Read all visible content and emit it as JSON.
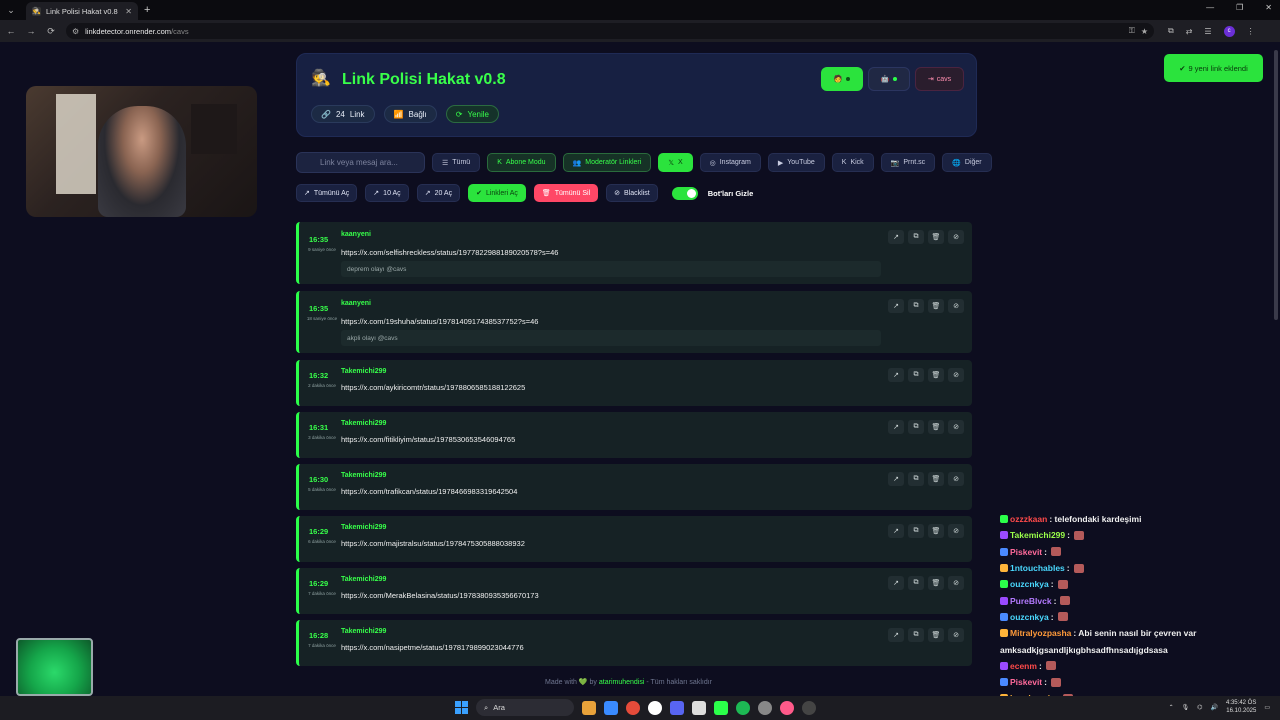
{
  "browser": {
    "tab_title": "Link Polisi Hakat v0.8",
    "url_host": "linkdetector.onrender.com",
    "url_path": "/cavs",
    "profile_initial": "c"
  },
  "header": {
    "title": "Link Polisi Hakat v0.8",
    "logout_label": "cavs",
    "stats": {
      "link_count": "24",
      "link_label": "Link",
      "connection": "Bağlı",
      "refresh": "Yenile"
    }
  },
  "filters": {
    "search_placeholder": "Link veya mesaj ara...",
    "items": [
      "Tümü",
      "Abone Modu",
      "Moderatör Linkleri",
      "X",
      "Instagram",
      "YouTube",
      "Kick",
      "Prnt.sc",
      "Diğer"
    ]
  },
  "actions": {
    "open_all": "Tümünü Aç",
    "open_10": "10 Aç",
    "open_20": "20 Aç",
    "open_checked": "Linkleri Aç",
    "delete_all": "Tümünü Sil",
    "blacklist": "Blacklist",
    "hide_bots": "Bot'ları Gizle"
  },
  "links": [
    {
      "time": "16:35",
      "ago": "9 saniye önce",
      "user": "kaanyeni",
      "url": "https://x.com/selfishreckless/status/1977822988189020578?s=46",
      "msg": "deprem olayı @cavs"
    },
    {
      "time": "16:35",
      "ago": "18 saniye önce",
      "user": "kaanyeni",
      "url": "https://x.com/19shuha/status/1978140917438537752?s=46",
      "msg": "akpli olayı @cavs"
    },
    {
      "time": "16:32",
      "ago": "2 dakika önce",
      "user": "Takemichi299",
      "url": "https://x.com/aykiricomtr/status/1978806585188122625",
      "msg": ""
    },
    {
      "time": "16:31",
      "ago": "3 dakika önce",
      "user": "Takemichi299",
      "url": "https://x.com/fitikliyim/status/1978530653546094765",
      "msg": ""
    },
    {
      "time": "16:30",
      "ago": "5 dakika önce",
      "user": "Takemichi299",
      "url": "https://x.com/trafikcan/status/1978466983319642504",
      "msg": ""
    },
    {
      "time": "16:29",
      "ago": "6 dakika önce",
      "user": "Takemichi299",
      "url": "https://x.com/majistralsu/status/1978475305888038932",
      "msg": ""
    },
    {
      "time": "16:29",
      "ago": "7 dakika önce",
      "user": "Takemichi299",
      "url": "https://x.com/MerakBelasina/status/1978380935356670173",
      "msg": ""
    },
    {
      "time": "16:28",
      "ago": "7 dakika önce",
      "user": "Takemichi299",
      "url": "https://x.com/nasipetme/status/1978179899023044776",
      "msg": ""
    }
  ],
  "footer": {
    "made_with": "Made with",
    "by": "by",
    "author": "atarimuhendisi",
    "rights": "- Tüm hakları saklıdır"
  },
  "toast": "9 yeni link eklendi",
  "chat": [
    {
      "user": "ozzzkaan",
      "color": "#ff4a4a",
      "text": " : telefondaki kardeşimi"
    },
    {
      "user": "Takemichi299",
      "color": "#9aff4a",
      "text": " :"
    },
    {
      "user": "Piskevit",
      "color": "#ff6a9a",
      "text": " :"
    },
    {
      "user": "1ntouchables",
      "color": "#4ad9ff",
      "text": " :"
    },
    {
      "user": "ouzcnkya",
      "color": "#4ad9ff",
      "text": " :"
    },
    {
      "user": "PureBlvck",
      "color": "#b47aff",
      "text": " :"
    },
    {
      "user": "ouzcnkya",
      "color": "#4ad9ff",
      "text": " :"
    },
    {
      "user": "Mitralyozpasha",
      "color": "#ff9a3a",
      "text": " : Abi senin nasıl bir çevren var"
    },
    {
      "user": "",
      "color": "#f0f0f0",
      "text": "amksadkjgsandljkıgbhsadfhnsadıjgdsasa"
    },
    {
      "user": "ecenm",
      "color": "#ff4a4a",
      "text": " :"
    },
    {
      "user": "Piskevit",
      "color": "#ff6a9a",
      "text": " :"
    },
    {
      "user": "burakyagiz",
      "color": "#ffb43a",
      "text": " :"
    }
  ],
  "taskbar": {
    "search": "Ara",
    "time": "4:35:42 ÖS",
    "date": "16.10.2025"
  },
  "colors": {
    "accent": "#2be33d",
    "danger": "#ff4766",
    "bg": "#0d0d1f"
  }
}
